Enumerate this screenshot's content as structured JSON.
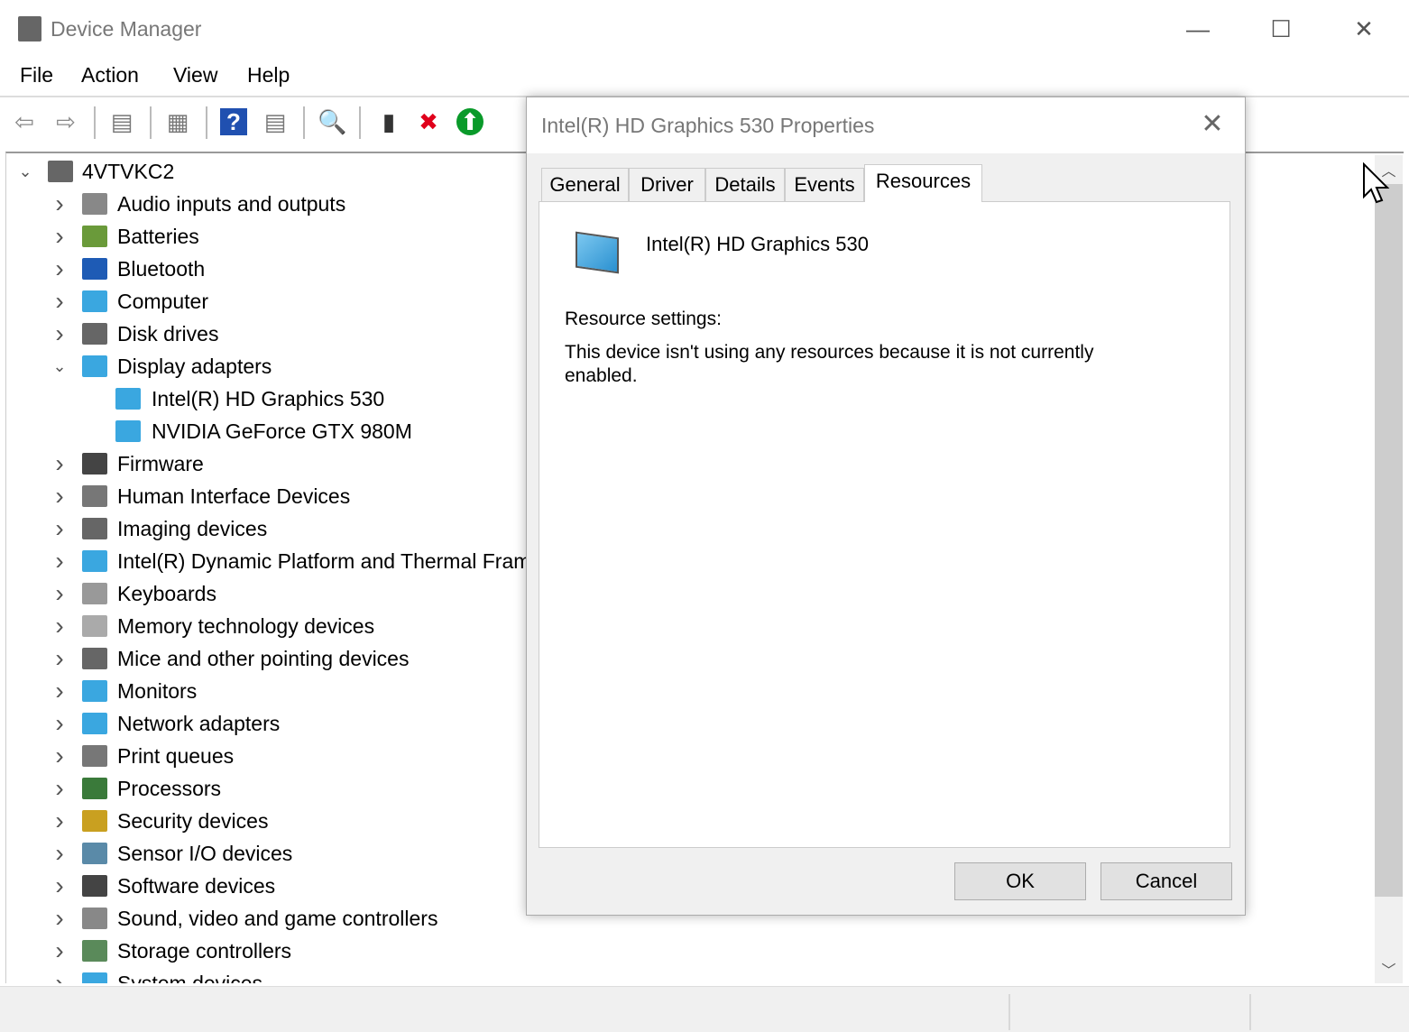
{
  "window": {
    "title": "Device Manager",
    "minimize": "—",
    "maximize": "☐",
    "close": "✕"
  },
  "menu": [
    "File",
    "Action",
    "View",
    "Help"
  ],
  "toolbar": [
    {
      "name": "back-icon",
      "glyph": "⇦",
      "color": "#888"
    },
    {
      "name": "forward-icon",
      "glyph": "⇨",
      "color": "#888"
    },
    {
      "name": "show-hide-console-tree-icon",
      "glyph": "▤",
      "color": "#777"
    },
    {
      "name": "properties-icon",
      "glyph": "▦",
      "color": "#777"
    },
    {
      "name": "help-icon",
      "glyph": "?",
      "color": "#fff"
    },
    {
      "name": "show-action-pane-icon",
      "glyph": "▤",
      "color": "#777"
    },
    {
      "name": "scan-hardware-icon",
      "glyph": "🔍",
      "color": "#3399dd"
    },
    {
      "name": "update-driver-icon",
      "glyph": "▮",
      "color": "#333"
    },
    {
      "name": "uninstall-device-icon",
      "glyph": "✖",
      "color": "#e0001b"
    },
    {
      "name": "enable-device-icon",
      "glyph": "⬆",
      "color": "#fff"
    }
  ],
  "tree": {
    "root": "4VTVKC2",
    "items": [
      {
        "label": "Audio inputs and outputs",
        "color": "#888"
      },
      {
        "label": "Batteries",
        "color": "#6a9a3a"
      },
      {
        "label": "Bluetooth",
        "color": "#1e5bb5"
      },
      {
        "label": "Computer",
        "color": "#3aa7e0"
      },
      {
        "label": "Disk drives",
        "color": "#666"
      },
      {
        "label": "Display adapters",
        "color": "#3aa7e0",
        "expanded": true,
        "children": [
          {
            "label": "Intel(R) HD Graphics 530"
          },
          {
            "label": "NVIDIA GeForce GTX 980M"
          }
        ]
      },
      {
        "label": "Firmware",
        "color": "#444"
      },
      {
        "label": "Human Interface Devices",
        "color": "#777"
      },
      {
        "label": "Imaging devices",
        "color": "#666"
      },
      {
        "label": "Intel(R) Dynamic Platform and Thermal Framework",
        "color": "#3aa7e0"
      },
      {
        "label": "Keyboards",
        "color": "#999"
      },
      {
        "label": "Memory technology devices",
        "color": "#aaa"
      },
      {
        "label": "Mice and other pointing devices",
        "color": "#666"
      },
      {
        "label": "Monitors",
        "color": "#3aa7e0"
      },
      {
        "label": "Network adapters",
        "color": "#3aa7e0"
      },
      {
        "label": "Print queues",
        "color": "#777"
      },
      {
        "label": "Processors",
        "color": "#3a7a3a"
      },
      {
        "label": "Security devices",
        "color": "#c9a020"
      },
      {
        "label": "Sensor I/O devices",
        "color": "#5a8aa8"
      },
      {
        "label": "Software devices",
        "color": "#444"
      },
      {
        "label": "Sound, video and game controllers",
        "color": "#888"
      },
      {
        "label": "Storage controllers",
        "color": "#5a8a5a"
      },
      {
        "label": "System devices",
        "color": "#3aa7e0"
      }
    ]
  },
  "dialog": {
    "title": "Intel(R) HD Graphics 530 Properties",
    "close": "✕",
    "tabs": [
      "General",
      "Driver",
      "Details",
      "Events",
      "Resources"
    ],
    "active_tab": "Resources",
    "device_name": "Intel(R) HD Graphics 530",
    "resource_settings_label": "Resource settings:",
    "message": "This device isn't using any resources because it is not currently enabled.",
    "ok": "OK",
    "cancel": "Cancel"
  }
}
